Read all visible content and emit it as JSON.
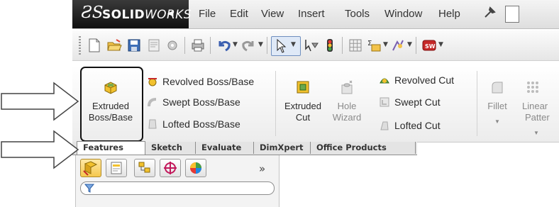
{
  "app": {
    "logo_prefix": "ƧS",
    "logo_bold": "SOLID",
    "logo_thin": "WORKS"
  },
  "menubar": {
    "items": [
      "File",
      "Edit",
      "View",
      "Insert",
      "Tools",
      "Window",
      "Help"
    ]
  },
  "ribbon": {
    "extruded_boss": [
      "Extruded",
      "Boss/Base"
    ],
    "revolved_boss": "Revolved Boss/Base",
    "swept_boss": "Swept Boss/Base",
    "lofted_boss": "Lofted Boss/Base",
    "extruded_cut": [
      "Extruded",
      "Cut"
    ],
    "hole_wizard": [
      "Hole",
      "Wizard"
    ],
    "revolved_cut": "Revolved Cut",
    "swept_cut": "Swept Cut",
    "lofted_cut": "Lofted Cut",
    "fillet": "Fillet",
    "linear_pattern": [
      "Linear",
      "Patter"
    ]
  },
  "tabs": [
    "Features",
    "Sketch",
    "Evaluate",
    "DimXpert",
    "Office Products"
  ],
  "active_tab": "Features",
  "panel": {
    "more_glyph": "»"
  },
  "colors": {
    "feature_yellow": "#f2c12e",
    "feature_green": "#6aa84f",
    "highlight_frame": "#111111",
    "logo_background": "#1a1a1a"
  }
}
